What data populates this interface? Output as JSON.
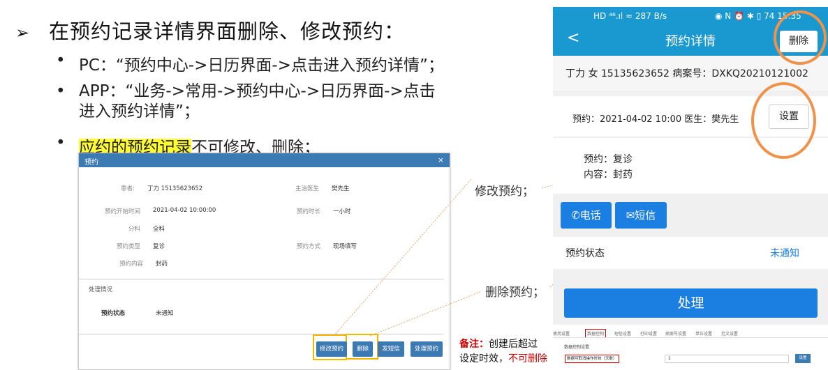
{
  "heading": {
    "arrow": "➢",
    "text": "在预约记录详情界面删除、修改预约："
  },
  "bullets": [
    {
      "dot": "•",
      "text": "PC：“预约中心->日历界面->点击进入预约详情”；"
    },
    {
      "dot": "•",
      "line1": "APP：“业务->常用->预约中心->日历界面->点击",
      "line2": "进入预约详情”；"
    },
    {
      "dot": "•",
      "highlight": "应约的预约记录",
      "rest": "不可修改、删除；"
    }
  ],
  "pc_dialog": {
    "title": "预约",
    "close": "×",
    "patient_label": "患者:",
    "patient_value": "丁力 15135623652",
    "doctor_label": "主治医生",
    "doctor_value": "樊先生",
    "start_label": "预约开始时间",
    "start_value": "2021-04-02 10:00:00",
    "duration_label": "预约时长",
    "duration_value": "一小时",
    "dept_label": "分科",
    "dept_value": "全科",
    "type_label": "预约类型",
    "type_value": "复诊",
    "mode_label": "预约方式",
    "mode_value": "现场填写",
    "content_label": "预约内容",
    "content_value": "封药",
    "section_title": "处理情况",
    "status_label": "预约状态",
    "status_value": "未通知",
    "buttons": {
      "modify": "修改预约",
      "delete": "删除",
      "sms": "发短信",
      "handle": "处理预约"
    }
  },
  "annotations": {
    "modify": "修改预约；",
    "delete": "删除预约；"
  },
  "note": {
    "label": "备注：",
    "text1": "创建后超过",
    "text2": "设定时效，",
    "red": "不可删除"
  },
  "phone": {
    "status_left": "HD ⁴⁶.ıl ≈ 287 B/s",
    "status_right": "◉ N ⏰ ✱ ▯ 74 15:35",
    "back": "<",
    "title": "预约详情",
    "delete": "删除",
    "patient_line": "丁力 女 15135623652   病案号：DXKQ20210121002",
    "appointment_line": "预约：2021-04-02 10:00   医生：樊先生",
    "settings": "设置",
    "visit_type": "预约：复诊",
    "content": "内容：封药",
    "call": "电话",
    "sms": "短信",
    "status_label": "预约状态",
    "status_value": "未通知",
    "handle": "处理",
    "settings_tabs": [
      "使用设置",
      "数据控制",
      "短信设置",
      "打印设置",
      "病案号设置",
      "单位设置",
      "范文设置"
    ],
    "settings_section": "数据控制设置",
    "settings_field": "数据可取消操作时效（天数）",
    "settings_value": "1",
    "settings_button": "设置"
  }
}
